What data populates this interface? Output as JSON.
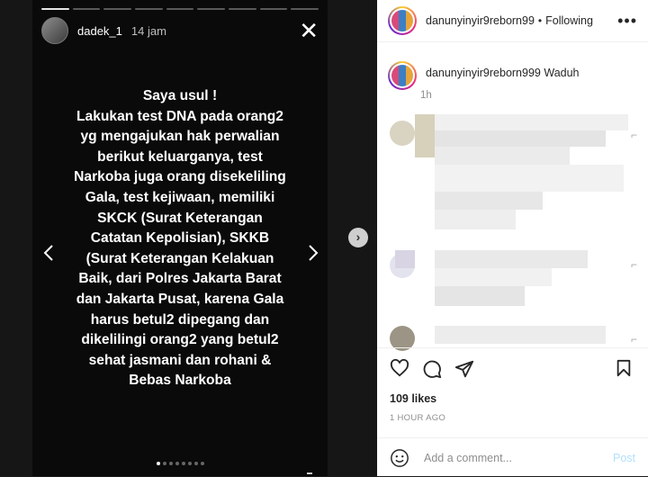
{
  "story": {
    "username": "dadek_1",
    "time": "14 jam",
    "progress_total": 9,
    "progress_done": 1,
    "text": "Saya usul !\nLakukan test DNA pada orang2\nyg mengajukan hak perwalian\nberikut keluarganya, test\nNarkoba juga orang disekeliling\nGala, test kejiwaan, memiliki\nSKCK (Surat Keterangan\nCatatan Kepolisian), SKKB\n(Surat Keterangan Kelakuan\nBaik, dari Polres Jakarta Barat\ndan Jakarta Pusat, karena Gala\nharus betul2 dipegang dan\ndikelilingi orang2 yang betul2\nsehat jasmani dan rohani &\nBebas Narkoba",
    "dots_total": 8,
    "dots_active": 1
  },
  "post": {
    "username": "danunyinyir9reborn99",
    "separator": "•",
    "follow_label": "Following",
    "caption_user": "danunyinyir9reborn999",
    "caption_text": "Waduh",
    "caption_time": "1h",
    "likes": "109 likes",
    "time_ago": "1 HOUR AGO",
    "comment_placeholder": "Add a comment...",
    "post_label": "Post"
  },
  "colors": {
    "accent_link": "#b2dffc",
    "story_bg": "#0a0a0a"
  }
}
